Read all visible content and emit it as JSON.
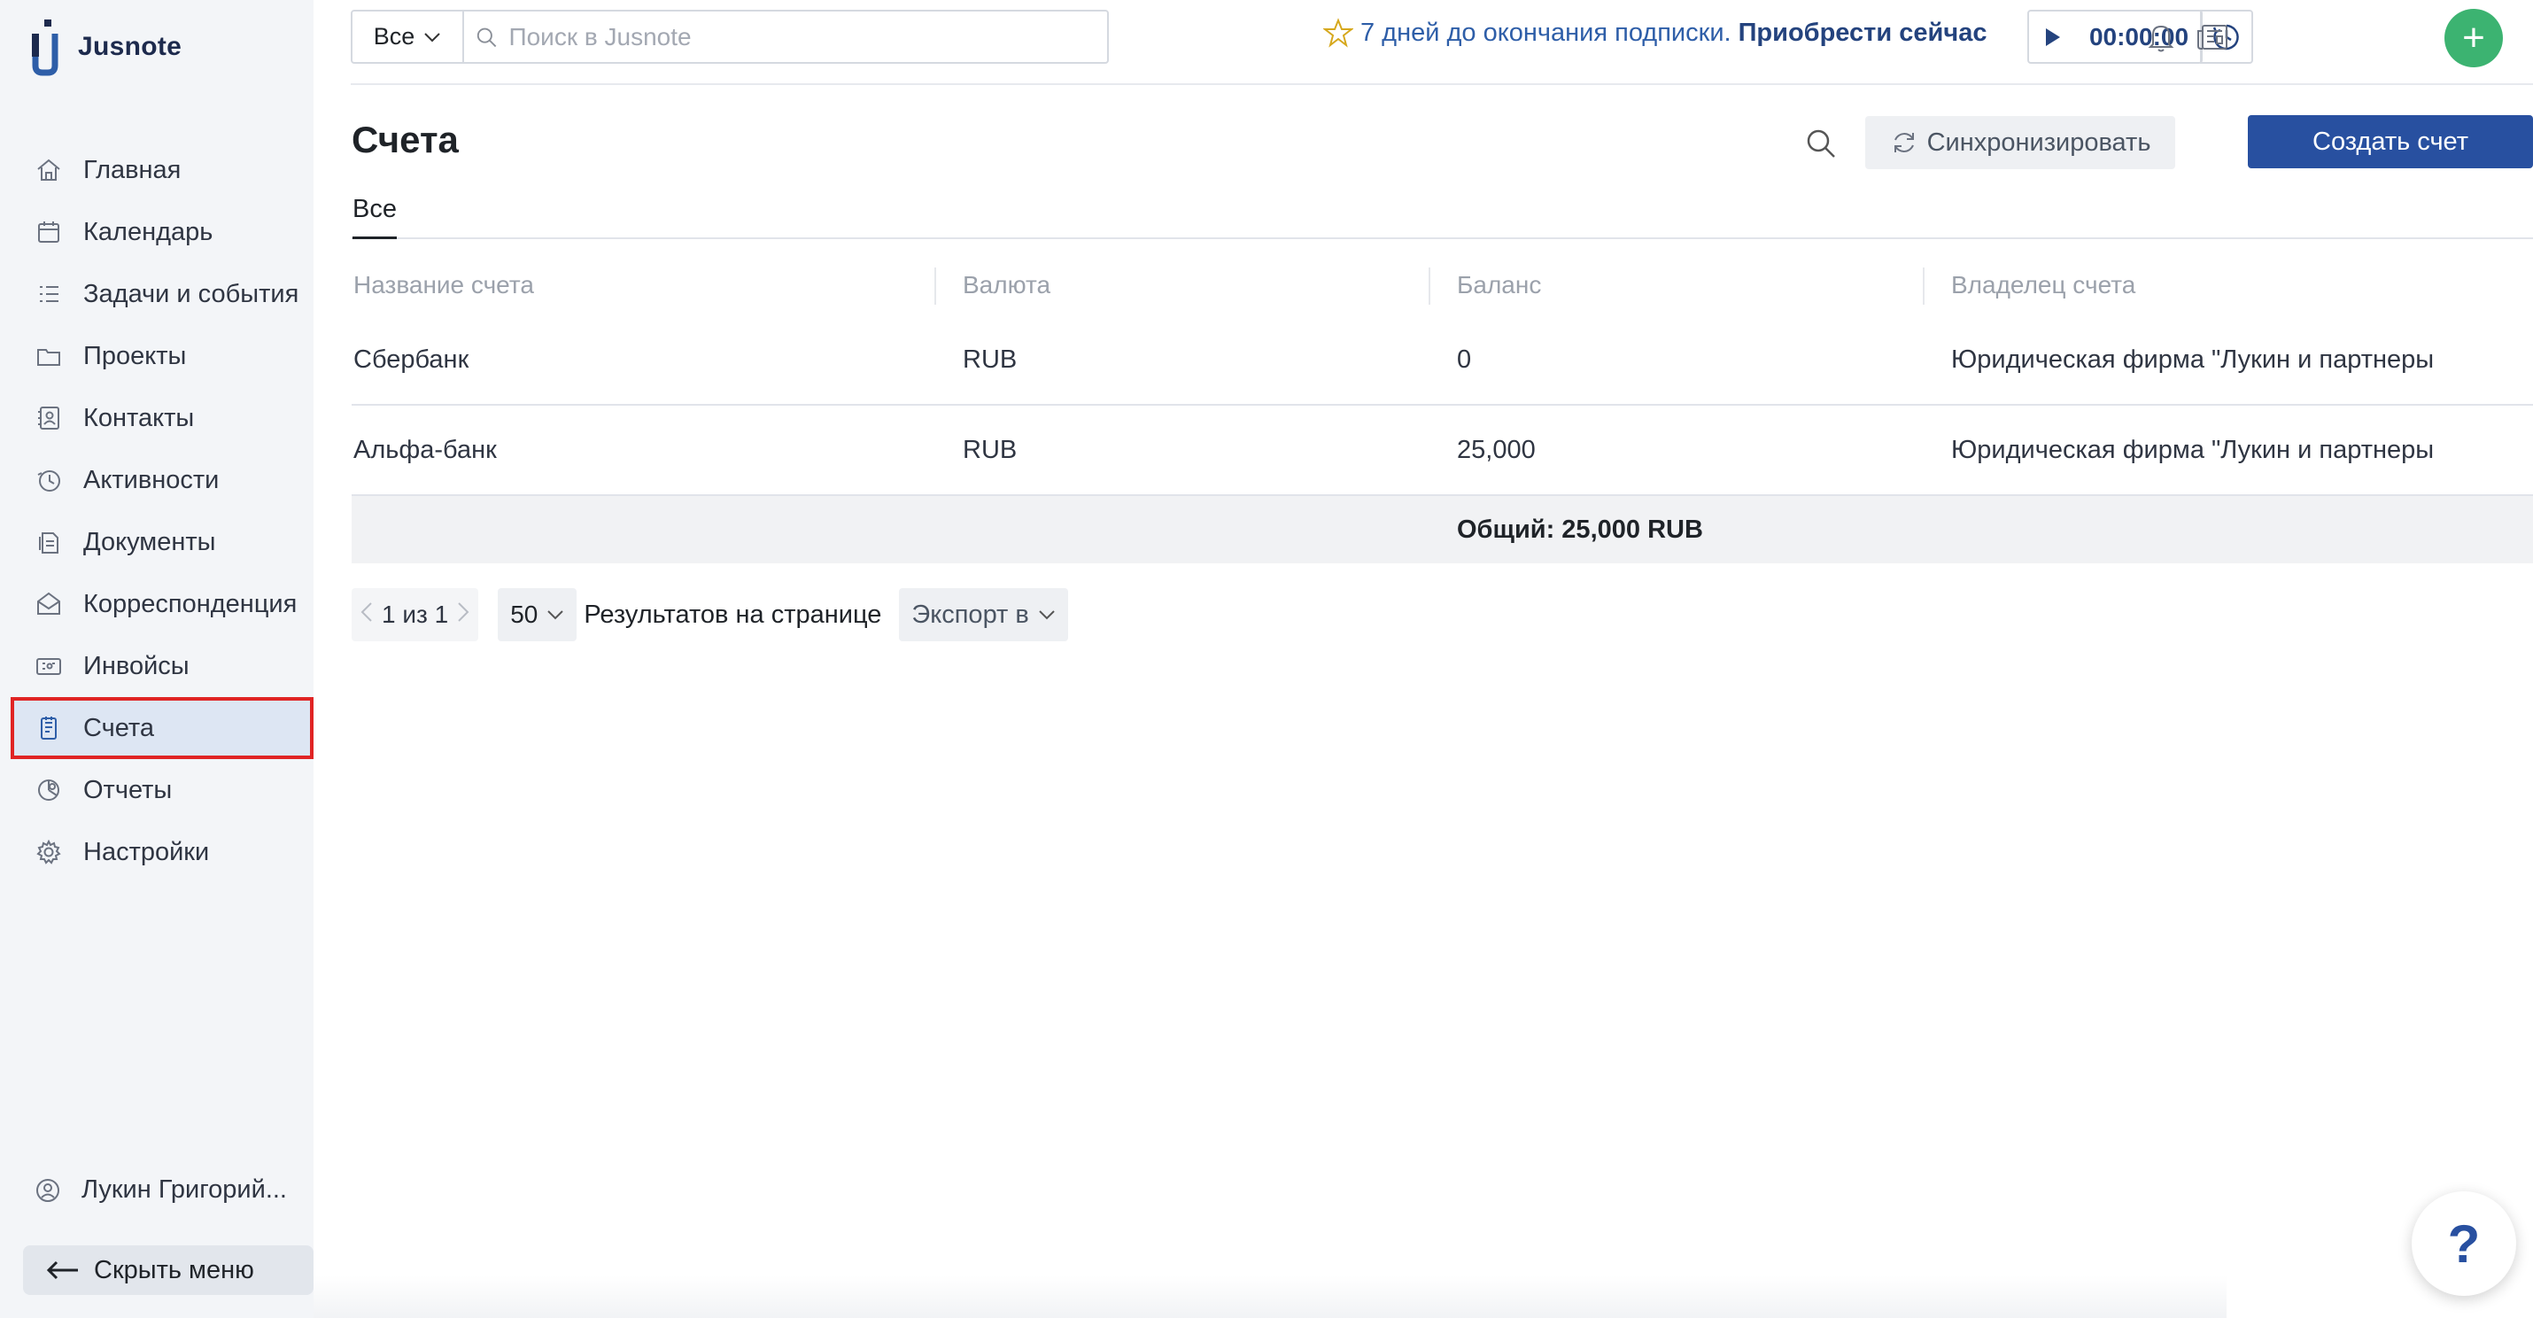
{
  "app": {
    "name": "Jusnote",
    "accent": "#2850a0",
    "active_outline": "#e02424",
    "success": "#3cb371"
  },
  "sidebar": {
    "items": [
      {
        "label": "Главная",
        "icon": "home-icon"
      },
      {
        "label": "Календарь",
        "icon": "calendar-icon"
      },
      {
        "label": "Задачи и события",
        "icon": "tasks-icon"
      },
      {
        "label": "Проекты",
        "icon": "folder-icon"
      },
      {
        "label": "Контакты",
        "icon": "contacts-icon"
      },
      {
        "label": "Активности",
        "icon": "activity-icon"
      },
      {
        "label": "Документы",
        "icon": "documents-icon"
      },
      {
        "label": "Корреспонденция",
        "icon": "mail-icon"
      },
      {
        "label": "Инвойсы",
        "icon": "invoice-icon"
      },
      {
        "label": "Счета",
        "icon": "accounts-icon",
        "active": true
      },
      {
        "label": "Отчеты",
        "icon": "reports-icon"
      },
      {
        "label": "Настройки",
        "icon": "settings-icon"
      }
    ],
    "user": "Лукин Григорий...",
    "hide_menu": "Скрыть меню"
  },
  "topbar": {
    "scope": "Все",
    "search_placeholder": "Поиск в Jusnote",
    "promo_text": "7 дней до окончания подписки.",
    "promo_link": "Приобрести сейчас",
    "timer": "00:00:00"
  },
  "page": {
    "title": "Счета",
    "sync_label": "Синхронизировать",
    "create_label": "Создать счет",
    "tab_all": "Все"
  },
  "table": {
    "headers": [
      "Название счета",
      "Валюта",
      "Баланс",
      "Владелец счета"
    ],
    "rows": [
      [
        "Сбербанк",
        "RUB",
        "0",
        "Юридическая фирма \"Лукин и партнеры\""
      ],
      [
        "Альфа-банк",
        "RUB",
        "25,000",
        "Юридическая фирма \"Лукин и партнеры\""
      ]
    ],
    "total": "Общий: 25,000 RUB"
  },
  "pager": {
    "range": "1 из 1",
    "per_page": "50",
    "per_page_label": "Результатов на странице",
    "export": "Экспорт в"
  },
  "help": "?"
}
